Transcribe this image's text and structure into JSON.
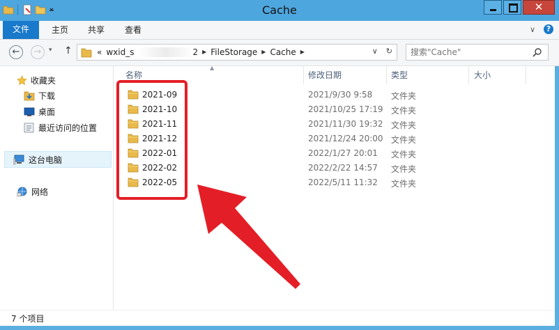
{
  "window": {
    "title": "Cache"
  },
  "quick_access": {
    "icons": [
      "folder-icon",
      "properties-icon",
      "new-folder-icon",
      "dropdown-icon"
    ]
  },
  "ribbon": {
    "tabs": [
      "文件",
      "主页",
      "共享",
      "查看"
    ]
  },
  "address": {
    "crumbs": [
      "«",
      "wxid_s",
      "2",
      "FileStorage",
      "Cache"
    ],
    "search_placeholder": "搜索\"Cache\""
  },
  "sidebar": {
    "items": [
      {
        "label": "收藏夹",
        "icon": "star-icon"
      },
      {
        "label": "下载",
        "icon": "download-folder-icon"
      },
      {
        "label": "桌面",
        "icon": "desktop-icon"
      },
      {
        "label": "最近访问的位置",
        "icon": "recent-places-icon"
      },
      {
        "label": "这台电脑",
        "icon": "computer-icon"
      },
      {
        "label": "网络",
        "icon": "network-icon"
      }
    ]
  },
  "columns": {
    "name": "名称",
    "date": "修改日期",
    "type": "类型",
    "size": "大小"
  },
  "files": [
    {
      "name": "2021-09",
      "date": "2021/9/30 9:58",
      "type": "文件夹"
    },
    {
      "name": "2021-10",
      "date": "2021/10/25 17:19",
      "type": "文件夹"
    },
    {
      "name": "2021-11",
      "date": "2021/11/30 19:32",
      "type": "文件夹"
    },
    {
      "name": "2021-12",
      "date": "2021/12/24 20:00",
      "type": "文件夹"
    },
    {
      "name": "2022-01",
      "date": "2022/1/27 20:01",
      "type": "文件夹"
    },
    {
      "name": "2022-02",
      "date": "2022/2/22 14:57",
      "type": "文件夹"
    },
    {
      "name": "2022-05",
      "date": "2022/5/11 11:32",
      "type": "文件夹"
    }
  ],
  "status": {
    "count": "7 个项目"
  },
  "colors": {
    "accent": "#1979ca",
    "annotation": "#e41e26",
    "titlebar": "#4ea6de"
  }
}
